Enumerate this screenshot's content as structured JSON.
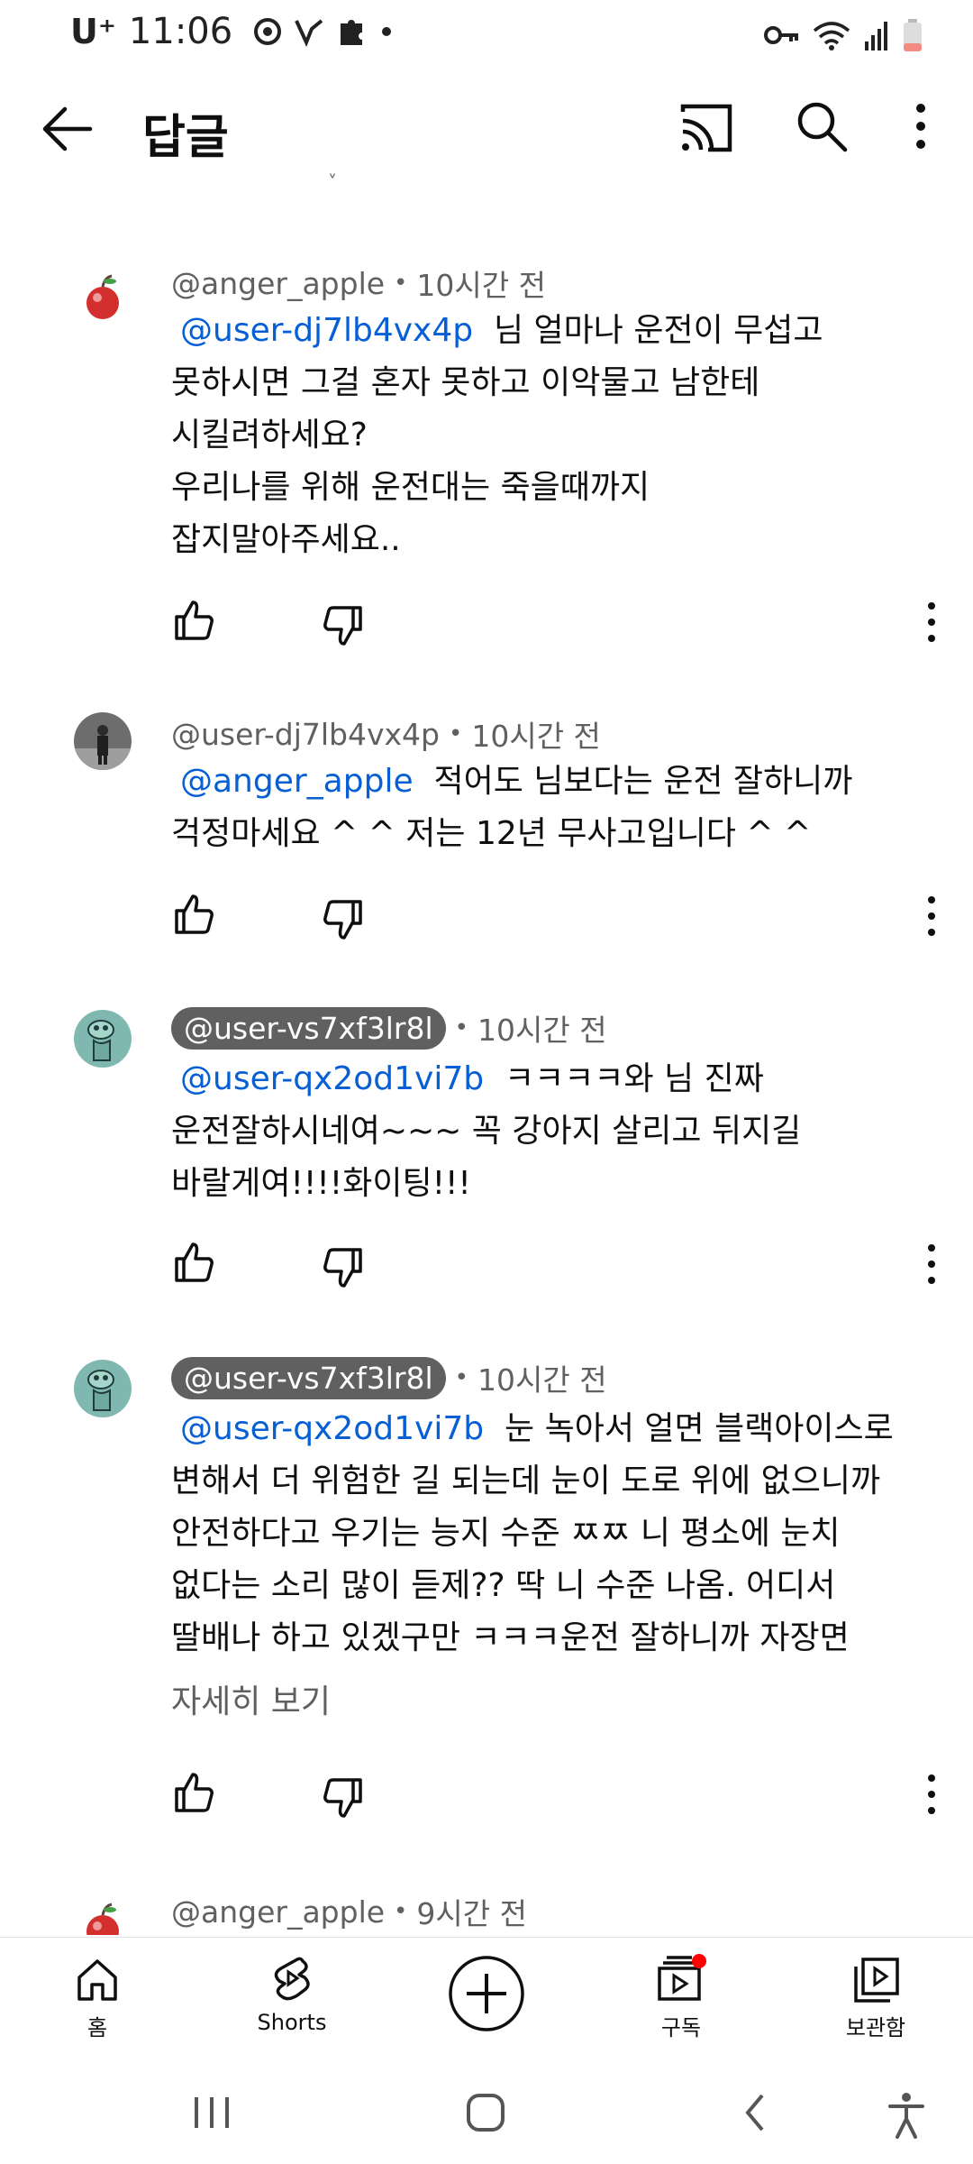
{
  "status_bar": {
    "carrier": "U⁺",
    "time": "11:06"
  },
  "app_bar": {
    "title": "답글"
  },
  "comments": [
    {
      "author": "@anger_apple",
      "time": "10시간 전",
      "mention": "@user-dj7lb4vx4p",
      "text": "님 얼마나 운전이 무섭고\n못하시면 그걸 혼자 못하고 이악물고 남한테\n시킬려하세요?\n우리나를 위해 운전대는 죽을때까지\n잡지말아주세요.."
    },
    {
      "author": "@user-dj7lb4vx4p",
      "time": "10시간 전",
      "mention": "@anger_apple",
      "text": "적어도 님보다는 운전 잘하니까\n걱정마세요 ^ ^ 저는 12년 무사고입니다 ^ ^"
    },
    {
      "author": "@user-vs7xf3lr8l",
      "time": "10시간 전",
      "mention": "@user-qx2od1vi7b",
      "text": "ㅋㅋㅋㅋ와 님 진짜\n운전잘하시네여~~~ 꼭 강아지 살리고 뒤지길\n바랄게여!!!!화이팅!!!"
    },
    {
      "author": "@user-vs7xf3lr8l",
      "time": "10시간 전",
      "mention": "@user-qx2od1vi7b",
      "text": "눈 녹아서 얼면 블랙아이스로\n변해서 더 위험한 길 되는데 눈이 도로 위에 없으니까\n안전하다고 우기는 능지 수준 ㅉㅉ 니 평소에 눈치\n없다는 소리 많이 듣제?? 딱 니 수준 나옴. 어디서\n딸배나 하고 있겠구만 ㅋㅋㅋ운전 잘하니까 자장면",
      "read_more": "자세히 보기"
    },
    {
      "author": "@anger_apple",
      "time": "9시간 전"
    }
  ],
  "bottom_nav": {
    "home": "홈",
    "shorts": "Shorts",
    "subscriptions": "구독",
    "library": "보관함"
  },
  "colors": {
    "mention": "#065fd4",
    "meta": "#606060",
    "notification_dot": "#ff0000"
  }
}
